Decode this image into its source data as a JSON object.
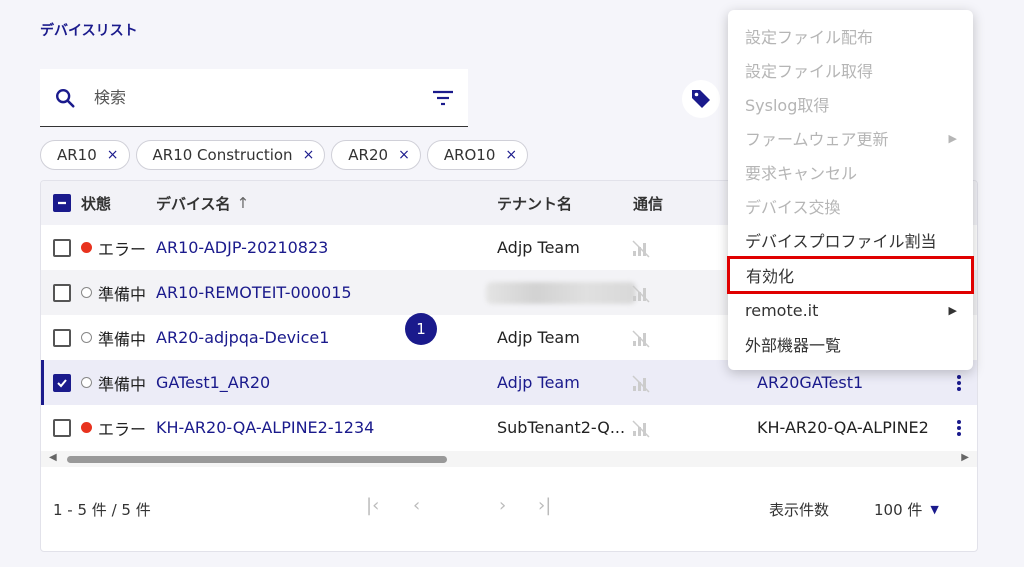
{
  "page": {
    "title": "デバイスリスト"
  },
  "search": {
    "placeholder": "検索"
  },
  "chips": [
    {
      "label": "AR10"
    },
    {
      "label": "AR10 Construction"
    },
    {
      "label": "AR20"
    },
    {
      "label": "ARO10"
    }
  ],
  "chip_remove": "×",
  "table": {
    "headers": {
      "status": "状態",
      "device_name": "デバイス名",
      "sort_arrow": "↑",
      "tenant": "テナント名",
      "comm": "通信"
    },
    "rows": [
      {
        "status": "エラー",
        "status_type": "error",
        "device": "AR10-ADJP-20210823",
        "tenant": "Adjp Team",
        "profile": "",
        "selected": false
      },
      {
        "status": "準備中",
        "status_type": "preparing",
        "device": "AR10-REMOTEIT-000015",
        "tenant": "",
        "profile": "",
        "selected": false
      },
      {
        "status": "準備中",
        "status_type": "preparing",
        "device": "AR20-adjpqa-Device1",
        "tenant": "Adjp Team",
        "profile": "",
        "selected": false
      },
      {
        "status": "準備中",
        "status_type": "preparing",
        "device": "GATest1_AR20",
        "tenant": "Adjp Team",
        "profile": "AR20GATest1",
        "selected": true
      },
      {
        "status": "エラー",
        "status_type": "error",
        "device": "KH-AR20-QA-ALPINE2-1234",
        "tenant": "SubTenant2-Q...",
        "profile": "KH-AR20-QA-ALPINE2",
        "selected": false
      }
    ]
  },
  "footer": {
    "range": "1 - 5 件 / 5 件",
    "current_page": "1",
    "page_size_label": "表示件数",
    "page_size_value": "100 件"
  },
  "menu": {
    "items": [
      {
        "label": "設定ファイル配布",
        "enabled": false
      },
      {
        "label": "設定ファイル取得",
        "enabled": false
      },
      {
        "label": "Syslog取得",
        "enabled": false
      },
      {
        "label": "ファームウェア更新",
        "enabled": false,
        "submenu": true
      },
      {
        "label": "要求キャンセル",
        "enabled": false
      },
      {
        "label": "デバイス交換",
        "enabled": false
      },
      {
        "label": "デバイスプロファイル割当",
        "enabled": true
      },
      {
        "label": "有効化",
        "enabled": true,
        "highlighted": true
      },
      {
        "label": "remote.it",
        "enabled": true,
        "submenu": true
      },
      {
        "label": "外部機器一覧",
        "enabled": true
      }
    ]
  },
  "colors": {
    "accent": "#1a1a8c",
    "error": "#e8321e",
    "highlight_box": "#e00000"
  }
}
